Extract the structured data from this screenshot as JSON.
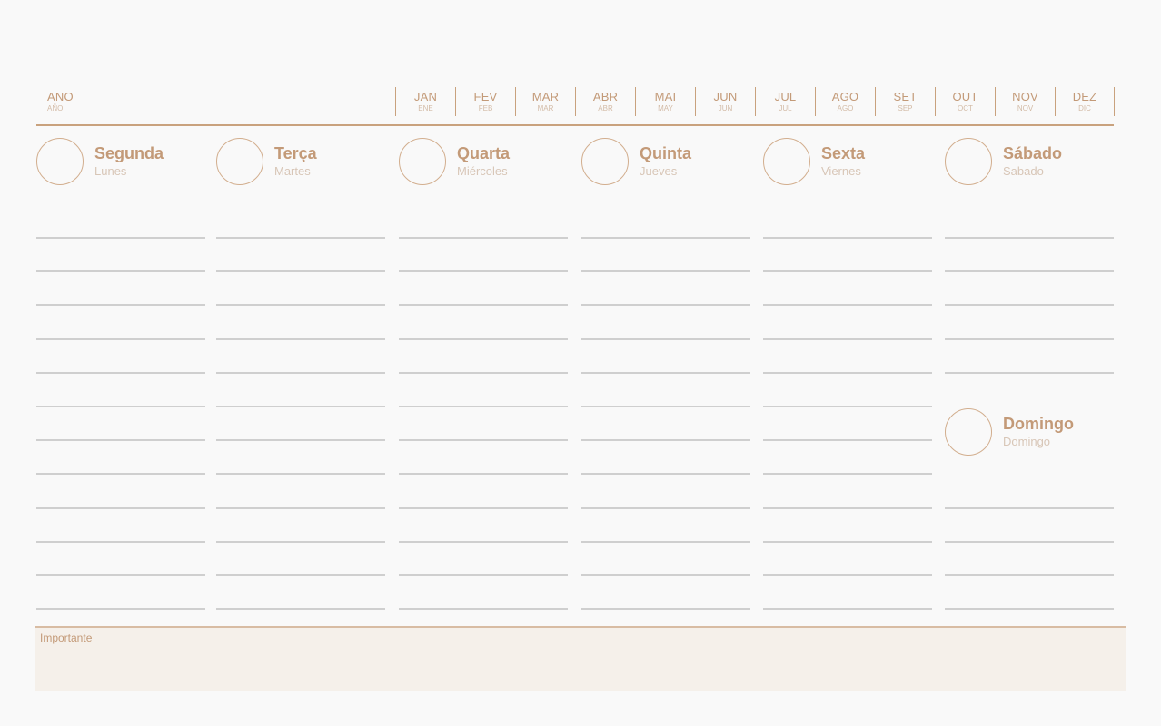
{
  "year": {
    "label": "ANO",
    "sub": "AÑO"
  },
  "months": [
    {
      "label": "JAN",
      "sub": "ENE"
    },
    {
      "label": "FEV",
      "sub": "FEB"
    },
    {
      "label": "MAR",
      "sub": "MAR"
    },
    {
      "label": "ABR",
      "sub": "ABR"
    },
    {
      "label": "MAI",
      "sub": "MAY"
    },
    {
      "label": "JUN",
      "sub": "JUN"
    },
    {
      "label": "JUL",
      "sub": "JUL"
    },
    {
      "label": "AGO",
      "sub": "AGO"
    },
    {
      "label": "SET",
      "sub": "SEP"
    },
    {
      "label": "OUT",
      "sub": "OCT"
    },
    {
      "label": "NOV",
      "sub": "NOV"
    },
    {
      "label": "DEZ",
      "sub": "DIC"
    }
  ],
  "days": [
    {
      "name": "Segunda",
      "sub": "Lunes"
    },
    {
      "name": "Terça",
      "sub": "Martes"
    },
    {
      "name": "Quarta",
      "sub": "Miércoles"
    },
    {
      "name": "Quinta",
      "sub": "Jueves"
    },
    {
      "name": "Sexta",
      "sub": "Viernes"
    },
    {
      "name": "Sábado",
      "sub": "Sabado"
    },
    {
      "name": "Domingo",
      "sub": "Domingo"
    }
  ],
  "important": {
    "label": "Importante"
  },
  "colors": {
    "accent": "#c39a78",
    "line": "#cfcfcf",
    "panel": "#f5f0ea"
  }
}
